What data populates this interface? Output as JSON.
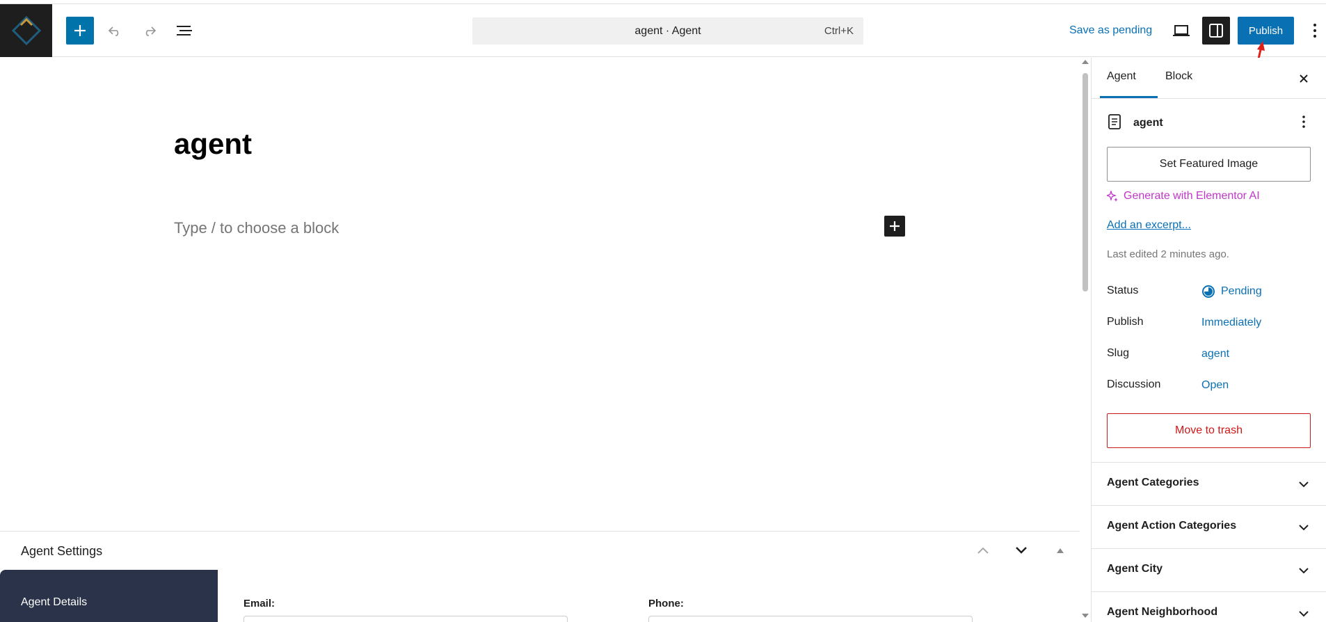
{
  "toolbar": {
    "command_title": "agent · Agent",
    "command_shortcut": "Ctrl+K",
    "save_pending_label": "Save as pending",
    "publish_label": "Publish"
  },
  "editor": {
    "post_title": "agent",
    "block_placeholder": "Type / to choose a block"
  },
  "meta_box": {
    "title": "Agent Settings",
    "side_item": "Agent Details",
    "fields": [
      {
        "label": "Email:"
      },
      {
        "label": "Phone:"
      }
    ]
  },
  "sidebar": {
    "tabs": [
      "Agent",
      "Block"
    ],
    "doc_title": "agent",
    "featured_image_label": "Set Featured Image",
    "elementor_ai_label": "Generate with Elementor AI",
    "excerpt_label": "Add an excerpt...",
    "last_edited": "Last edited 2 minutes ago.",
    "props": [
      {
        "label": "Status",
        "value": "Pending"
      },
      {
        "label": "Publish",
        "value": "Immediately"
      },
      {
        "label": "Slug",
        "value": "agent"
      },
      {
        "label": "Discussion",
        "value": "Open"
      }
    ],
    "trash_label": "Move to trash",
    "panels": [
      "Agent Categories",
      "Agent Action Categories",
      "Agent City",
      "Agent Neighborhood"
    ]
  },
  "colors": {
    "accent": "#0a70b4",
    "danger": "#cc1818",
    "ai": "#c036c9",
    "annotation": "#e0201a"
  }
}
